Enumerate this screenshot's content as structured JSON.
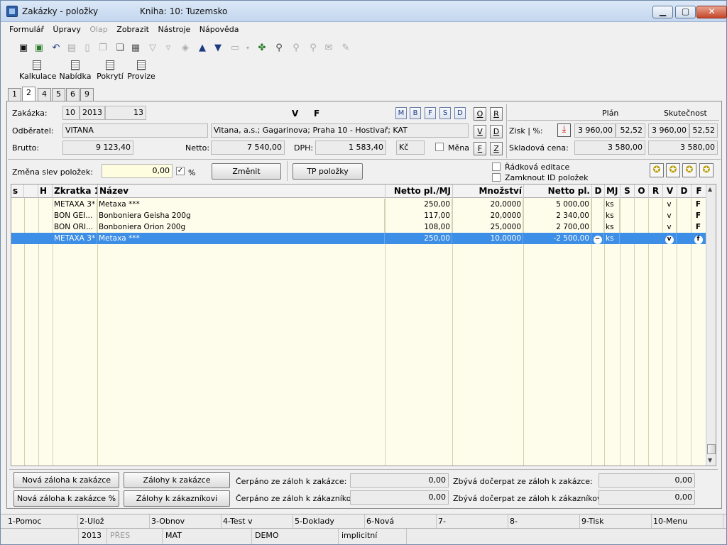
{
  "window": {
    "title": "Zakázky - položky",
    "book": "Kniha: 10: Tuzemsko",
    "min_glyph": "▁",
    "max_glyph": "▢",
    "close_glyph": "✕"
  },
  "menu": [
    "Formulář",
    "Úpravy",
    "Olap",
    "Zobrazit",
    "Nástroje",
    "Nápověda"
  ],
  "menu_disabled": [
    "Olap"
  ],
  "toolbar2": [
    "Kalkulace",
    "Nabídka",
    "Pokrytí",
    "Provize"
  ],
  "tabs": [
    "1",
    "2",
    "4",
    "5",
    "6",
    "9"
  ],
  "active_tab": "2",
  "form": {
    "zakazka_label": "Zakázka:",
    "zakazka_book": "10",
    "zakazka_year": "2013",
    "zakazka_num": "13",
    "flag_v": "V",
    "flag_f": "F",
    "small_buttons": [
      "M",
      "B",
      "F",
      "S",
      "D"
    ],
    "odberatel_label": "Odběratel:",
    "odberatel": "VITANA",
    "odberatel_addr": "Vitana, a.s.; Gagarinova; Praha 10 - Hostivař; KAT",
    "brutto_label": "Brutto:",
    "brutto": "9 123,40",
    "netto_label": "Netto:",
    "netto": "7 540,00",
    "dph_label": "DPH:",
    "dph": "1 583,40",
    "currency": "Kč",
    "mena_label": "Měna",
    "side_buttons": [
      "O",
      "R",
      "V",
      "D",
      "F",
      "Z"
    ],
    "plan_label": "Plán",
    "skut_label": "Skutečnost",
    "zisk_label": "Zisk | %:",
    "zisk_plan": "3 960,00",
    "zisk_plan_pct": "52,52",
    "zisk_skut": "3 960,00",
    "zisk_skut_pct": "52,52",
    "sklad_label": "Skladová cena:",
    "sklad_plan": "3 580,00",
    "sklad_skut": "3 580,00",
    "zmena_label": "Změna slev položek:",
    "zmena_value": "0,00",
    "pct": "%",
    "zmenit_btn": "Změnit",
    "tp_btn": "TP položky",
    "radkova": "Řádková editace",
    "zamknout": "Zamknout ID položek"
  },
  "grid": {
    "headers": [
      "s",
      "H",
      "Zkratka 1",
      "Název",
      "Netto pl./MJ",
      "Množství",
      "Netto pl.",
      "D",
      "MJ",
      "S",
      "O",
      "R",
      "V",
      "D",
      "F"
    ],
    "rows": [
      {
        "zkratka": "METAXA 3*",
        "nazev": "Metaxa ***",
        "netto_mj": "250,00",
        "mnozstvi": "20,0000",
        "netto": "5 000,00",
        "d": "",
        "mj": "ks",
        "v": "v",
        "f": "F"
      },
      {
        "zkratka": "BON GEI...",
        "nazev": "Bonboniera Geisha 200g",
        "netto_mj": "117,00",
        "mnozstvi": "20,0000",
        "netto": "2 340,00",
        "d": "",
        "mj": "ks",
        "v": "v",
        "f": "F"
      },
      {
        "zkratka": "BON ORI...",
        "nazev": "Bonboniera Orion 200g",
        "netto_mj": "108,00",
        "mnozstvi": "25,0000",
        "netto": "2 700,00",
        "d": "",
        "mj": "ks",
        "v": "v",
        "f": "F"
      },
      {
        "zkratka": "METAXA 3*",
        "nazev": "Metaxa ***",
        "netto_mj": "250,00",
        "mnozstvi": "10,0000",
        "netto": "-2 500,00",
        "d": "−",
        "mj": "ks",
        "v": "v",
        "f": "f"
      }
    ],
    "selected_row": 3
  },
  "bottom": {
    "btn1": "Nová záloha k zakázce",
    "btn2": "Zálohy k zakázce",
    "btn3": "Nová záloha k zakázce %",
    "btn4": "Zálohy k zákazníkovi",
    "cerpano_zakazka_label": "Čerpáno ze záloh k zakázce:",
    "cerpano_zakazka": "0,00",
    "cerpano_zakaznik_label": "Čerpáno ze záloh k zákazníkovi:",
    "cerpano_zakaznik": "0,00",
    "zbyva_zakazka_label": "Zbývá dočerpat ze záloh k zakázce:",
    "zbyva_zakazka": "0,00",
    "zbyva_zakaznik_label": "Zbývá dočerpat ze záloh k zákazníkovi:",
    "zbyva_zakaznik": "0,00"
  },
  "fkeys": [
    "1-Pomoc",
    "2-Ulož",
    "3-Obnov",
    "4-Test v",
    "5-Doklady",
    "6-Nová",
    "7-",
    "8-",
    "9-Tisk",
    "10-Menu"
  ],
  "status": [
    "",
    "2013",
    "PŘES",
    "MAT",
    "DEMO",
    "implicitní"
  ]
}
